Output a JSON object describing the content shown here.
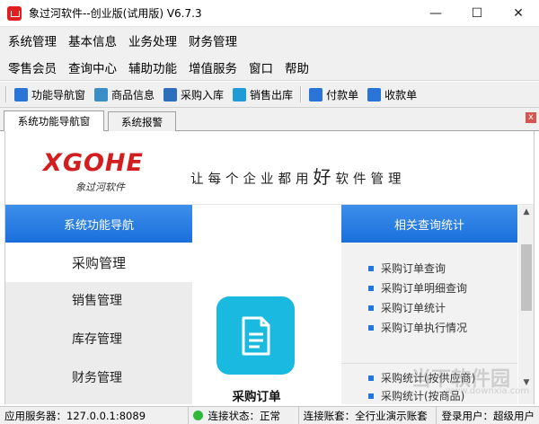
{
  "window": {
    "title": "象过河软件--创业版(试用版) V6.7.3",
    "controls": {
      "minimize": "—",
      "maximize": "☐",
      "close": "✕"
    }
  },
  "menubar_row1": [
    "系统管理",
    "基本信息",
    "业务处理",
    "财务管理"
  ],
  "menubar_row2": [
    "零售会员",
    "查询中心",
    "辅助功能",
    "增值服务",
    "窗口",
    "帮助"
  ],
  "toolbar": [
    {
      "label": "功能导航窗",
      "icon": "home-icon",
      "color": "#2a74d8"
    },
    {
      "label": "商品信息",
      "icon": "grid-icon",
      "color": "#3a8ec8"
    },
    {
      "label": "采购入库",
      "icon": "cart-in-icon",
      "color": "#2d6fbd"
    },
    {
      "label": "销售出库",
      "icon": "cart-out-icon",
      "color": "#1f9bd6"
    },
    {
      "label": "付款单",
      "icon": "payment-icon",
      "color": "#2a74d8"
    },
    {
      "label": "收款单",
      "icon": "receipt-icon",
      "color": "#2a74d8"
    }
  ],
  "tabs": [
    {
      "label": "系统功能导航窗",
      "active": true
    },
    {
      "label": "系统报警",
      "active": false
    }
  ],
  "tab_close": "x",
  "banner": {
    "logo": "XGOHE",
    "logo_sub": "象过河软件",
    "slogan_pre": "让每个企业都用",
    "slogan_big": "好",
    "slogan_post": "软件管理"
  },
  "left_nav": {
    "header": "系统功能导航",
    "items": [
      "采购管理",
      "销售管理",
      "库存管理",
      "财务管理"
    ]
  },
  "center": {
    "card_label": "采购订单",
    "icon": "document-icon"
  },
  "right_panel": {
    "header": "相关查询统计",
    "items": [
      "采购订单查询",
      "采购订单明细查询",
      "采购订单统计",
      "采购订单执行情况"
    ],
    "items2": [
      "采购统计(按供应商)",
      "采购统计(按商品)"
    ]
  },
  "watermark": {
    "main": "当下软件园",
    "sub": "www.downxia.com"
  },
  "statusbar": {
    "server": "应用服务器：127.0.0.1:8089",
    "connection": "连接状态：正常",
    "account": "连接账套：全行业演示账套",
    "user": "登录用户：超级用户"
  }
}
